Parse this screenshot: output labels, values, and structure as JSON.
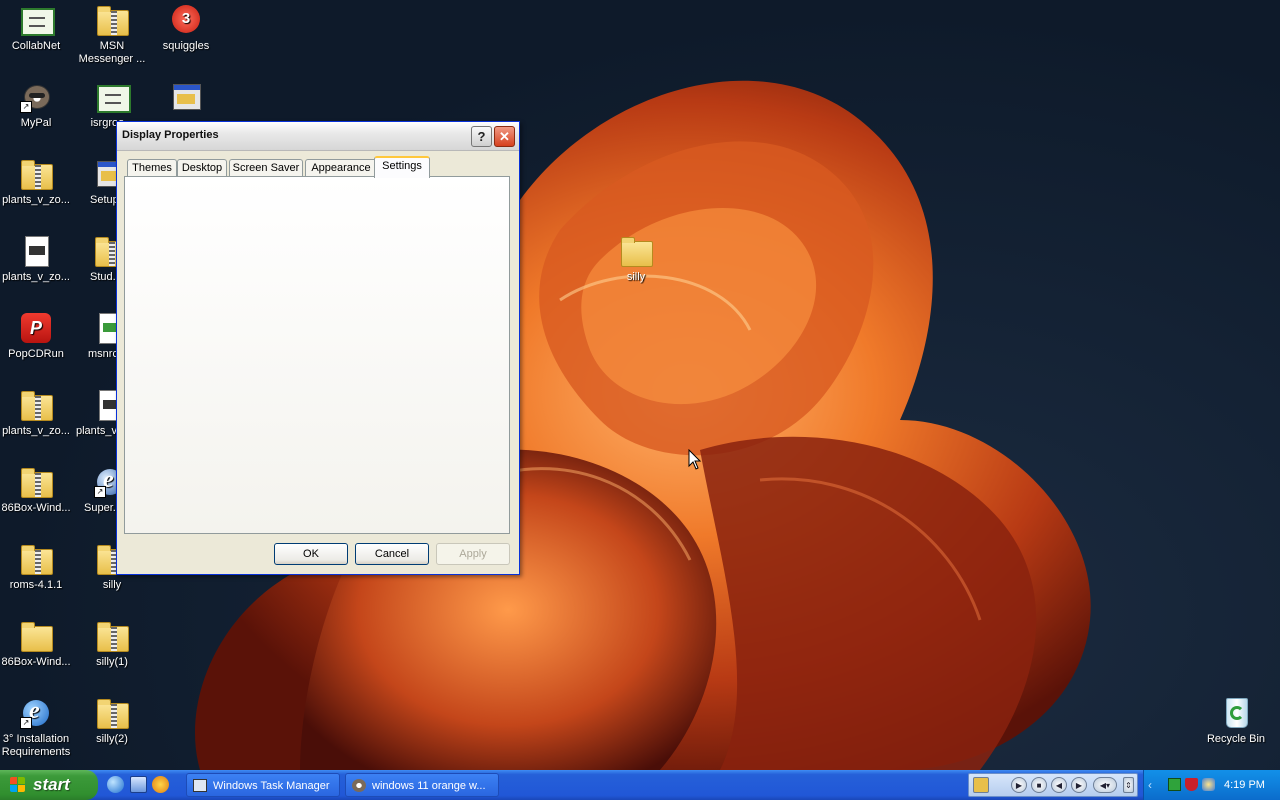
{
  "desktop": {
    "icons": [
      {
        "label": "CollabNet"
      },
      {
        "label": "MSN Messenger ..."
      },
      {
        "label": "squiggles",
        "badge": "3"
      },
      {
        "label": "MyPal"
      },
      {
        "label": "isrgroo..."
      },
      {
        "label": "plants_v_zo..."
      },
      {
        "label": "Setup"
      },
      {
        "label": "plants_v_zo..."
      },
      {
        "label": "Stud..."
      },
      {
        "label": "PopCDRun"
      },
      {
        "label": "msnrc..."
      },
      {
        "label": "plants_v_zo..."
      },
      {
        "label": "plants_v..."
      },
      {
        "label": "86Box-Wind..."
      },
      {
        "label": "Super..."
      },
      {
        "label": "roms-4.1.1"
      },
      {
        "label": "silly"
      },
      {
        "label": "86Box-Wind..."
      },
      {
        "label": "silly(1)"
      },
      {
        "label": "3° Installation Requirements"
      },
      {
        "label": "silly(2)"
      },
      {
        "label": "silly"
      },
      {
        "label": "Recycle Bin"
      }
    ]
  },
  "dialog": {
    "title": "Display Properties",
    "help_label": "?",
    "close_label": "✕",
    "tabs": [
      {
        "label": "Themes"
      },
      {
        "label": "Desktop"
      },
      {
        "label": "Screen Saver"
      },
      {
        "label": "Appearance"
      },
      {
        "label": "Settings",
        "active": true
      }
    ],
    "buttons": {
      "ok": "OK",
      "cancel": "Cancel",
      "apply": "Apply"
    }
  },
  "taskbar": {
    "start_label": "start",
    "tasks": [
      {
        "label": "Windows Task Manager"
      },
      {
        "label": "windows 11 orange w..."
      }
    ],
    "media_controls": [
      "play",
      "stop",
      "previous",
      "next",
      "volume"
    ],
    "clock": "4:19 PM"
  },
  "colors": {
    "taskbar_blue": "#2157d7",
    "start_green": "#3c9a3a",
    "tab_highlight": "#ffc83c",
    "wallpaper_orange": "#e8641f"
  }
}
